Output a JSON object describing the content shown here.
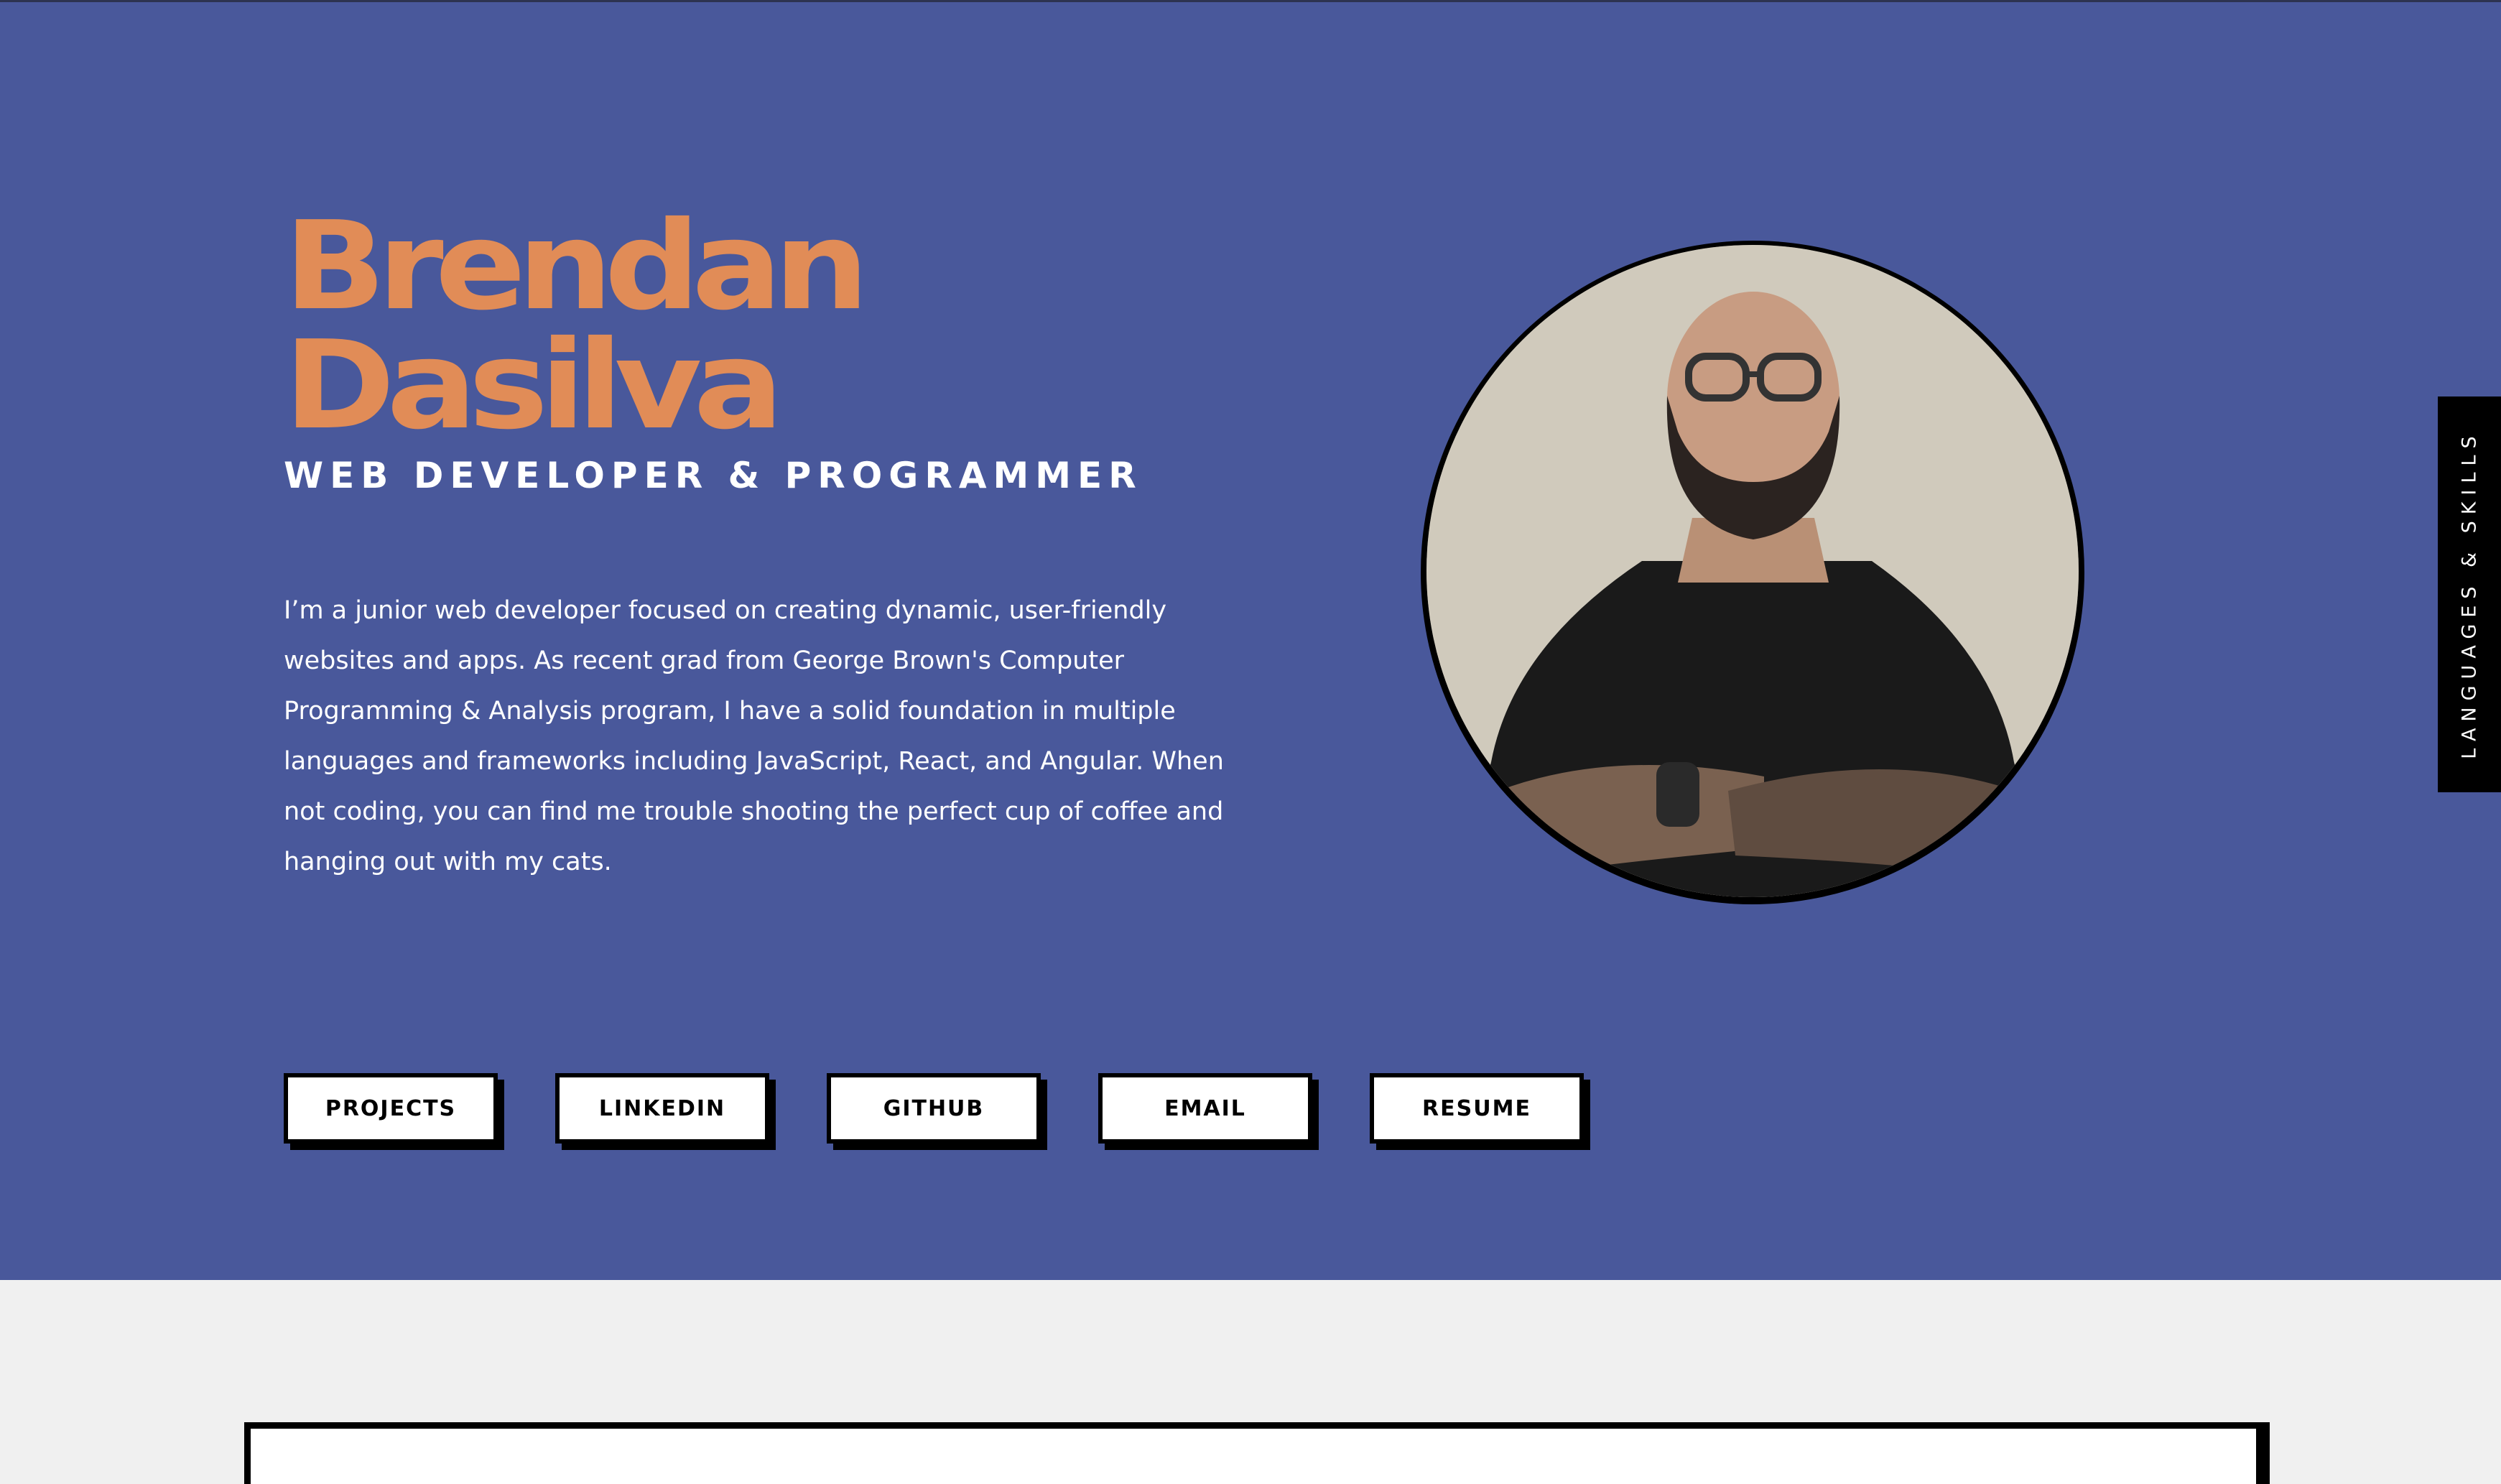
{
  "hero": {
    "name_first": "Brendan",
    "name_last": "Dasilva",
    "role": "WEB DEVELOPER & PROGRAMMER",
    "bio": "I’m a junior web developer focused on creating dynamic, user-friendly websites and apps. As recent grad from George Brown's Computer Programming & Analysis program, I have a solid foundation in multiple languages and frameworks including JavaScript, React, and Angular. When not coding, you can find me trouble shooting the perfect cup of coffee and hanging out with my cats."
  },
  "portrait": {
    "subject": "bearded man with glasses, black t-shirt, arms crossed, tattooed forearms"
  },
  "buttons": [
    {
      "label": "PROJECTS"
    },
    {
      "label": "LINKEDIN"
    },
    {
      "label": "GITHUB"
    },
    {
      "label": "EMAIL"
    },
    {
      "label": "RESUME"
    }
  ],
  "side_tab": {
    "label": "LANGUAGES & SKILLS"
  },
  "colors": {
    "hero_background": "#49589b",
    "name": "#e18c57",
    "page_background": "#f0f0f0",
    "button_background": "#ffffff",
    "button_border": "#000000",
    "side_tab_background": "#000000"
  }
}
